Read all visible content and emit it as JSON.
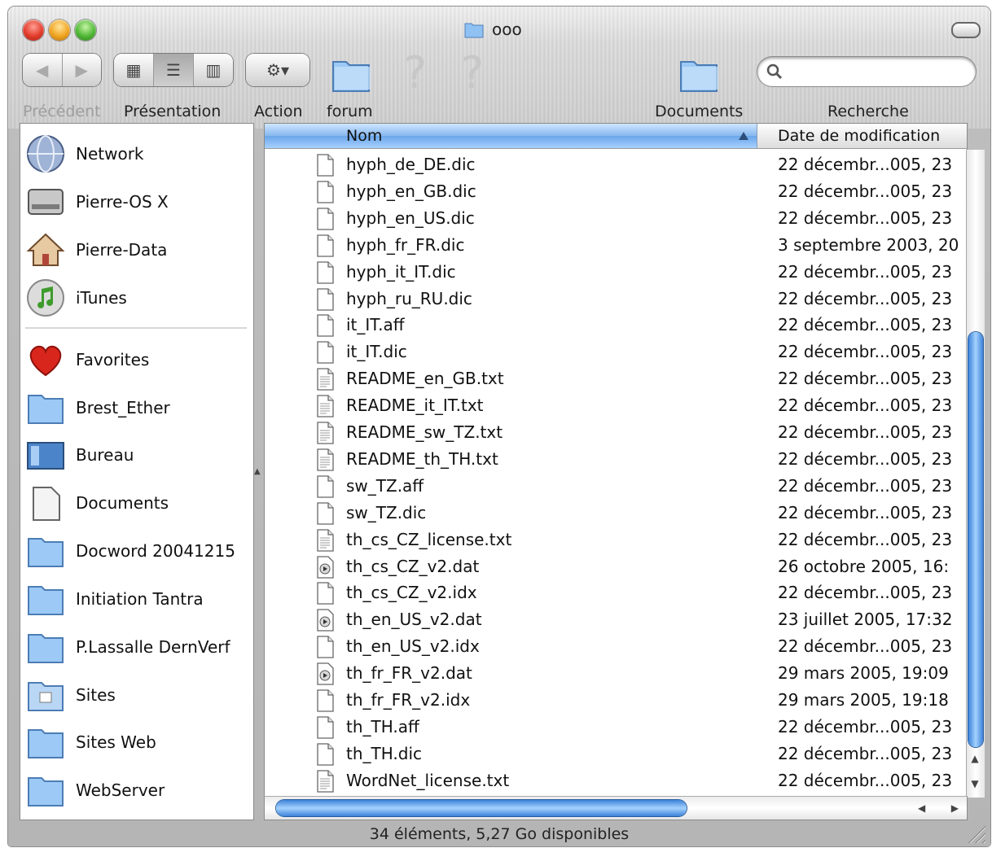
{
  "window": {
    "title": "ooo"
  },
  "toolbar": {
    "back_label": "Précédent",
    "view_label": "Présentation",
    "action_label": "Action",
    "forum_label": "forum",
    "documents_label": "Documents",
    "search_label": "Recherche",
    "search_value": ""
  },
  "sidebar": {
    "devices": [
      {
        "label": "Network",
        "icon": "globe-icon"
      },
      {
        "label": "Pierre-OS X",
        "icon": "hard-drive-icon"
      },
      {
        "label": "Pierre-Data",
        "icon": "home-icon"
      },
      {
        "label": "iTunes",
        "icon": "music-icon"
      }
    ],
    "places": [
      {
        "label": "Favorites",
        "icon": "heart-icon"
      },
      {
        "label": "Brest_Ether",
        "icon": "folder-icon"
      },
      {
        "label": "Bureau",
        "icon": "desktop-icon"
      },
      {
        "label": "Documents",
        "icon": "document-icon"
      },
      {
        "label": "Docword 20041215",
        "icon": "folder-icon"
      },
      {
        "label": "Initiation Tantra",
        "icon": "folder-icon"
      },
      {
        "label": "P.Lassalle DernVerf",
        "icon": "folder-icon"
      },
      {
        "label": "Sites",
        "icon": "sites-folder-icon"
      },
      {
        "label": "Sites Web",
        "icon": "folder-icon"
      },
      {
        "label": "WebServer",
        "icon": "folder-icon"
      }
    ]
  },
  "list": {
    "col_name": "Nom",
    "col_date": "Date de modification",
    "rows": [
      {
        "name": "hyph_de_DE.dic",
        "date": "22 décembr...005, 23",
        "icon": "blank-file-icon"
      },
      {
        "name": "hyph_en_GB.dic",
        "date": "22 décembr...005, 23",
        "icon": "blank-file-icon"
      },
      {
        "name": "hyph_en_US.dic",
        "date": "22 décembr...005, 23",
        "icon": "blank-file-icon"
      },
      {
        "name": "hyph_fr_FR.dic",
        "date": "3 septembre 2003, 20",
        "icon": "blank-file-icon"
      },
      {
        "name": "hyph_it_IT.dic",
        "date": "22 décembr...005, 23",
        "icon": "blank-file-icon"
      },
      {
        "name": "hyph_ru_RU.dic",
        "date": "22 décembr...005, 23",
        "icon": "blank-file-icon"
      },
      {
        "name": "it_IT.aff",
        "date": "22 décembr...005, 23",
        "icon": "blank-file-icon"
      },
      {
        "name": "it_IT.dic",
        "date": "22 décembr...005, 23",
        "icon": "blank-file-icon"
      },
      {
        "name": "README_en_GB.txt",
        "date": "22 décembr...005, 23",
        "icon": "text-file-icon"
      },
      {
        "name": "README_it_IT.txt",
        "date": "22 décembr...005, 23",
        "icon": "text-file-icon"
      },
      {
        "name": "README_sw_TZ.txt",
        "date": "22 décembr...005, 23",
        "icon": "text-file-icon"
      },
      {
        "name": "README_th_TH.txt",
        "date": "22 décembr...005, 23",
        "icon": "text-file-icon"
      },
      {
        "name": "sw_TZ.aff",
        "date": "22 décembr...005, 23",
        "icon": "blank-file-icon"
      },
      {
        "name": "sw_TZ.dic",
        "date": "22 décembr...005, 23",
        "icon": "blank-file-icon"
      },
      {
        "name": "th_cs_CZ_license.txt",
        "date": "22 décembr...005, 23",
        "icon": "text-file-icon"
      },
      {
        "name": "th_cs_CZ_v2.dat",
        "date": "26 octobre 2005, 16:",
        "icon": "media-file-icon"
      },
      {
        "name": "th_cs_CZ_v2.idx",
        "date": "22 décembr...005, 23",
        "icon": "blank-file-icon"
      },
      {
        "name": "th_en_US_v2.dat",
        "date": "23 juillet 2005, 17:32",
        "icon": "media-file-icon"
      },
      {
        "name": "th_en_US_v2.idx",
        "date": "22 décembr...005, 23",
        "icon": "blank-file-icon"
      },
      {
        "name": "th_fr_FR_v2.dat",
        "date": "29 mars 2005, 19:09",
        "icon": "media-file-icon"
      },
      {
        "name": "th_fr_FR_v2.idx",
        "date": "29 mars 2005, 19:18",
        "icon": "blank-file-icon"
      },
      {
        "name": "th_TH.aff",
        "date": "22 décembr...005, 23",
        "icon": "blank-file-icon"
      },
      {
        "name": "th_TH.dic",
        "date": "22 décembr...005, 23",
        "icon": "blank-file-icon"
      },
      {
        "name": "WordNet_license.txt",
        "date": "22 décembr...005, 23",
        "icon": "text-file-icon"
      }
    ]
  },
  "status": {
    "text": "34 éléments, 5,27 Go disponibles"
  },
  "colors": {
    "accent": "#3c82d9",
    "header_selected": "#86b7ee"
  }
}
